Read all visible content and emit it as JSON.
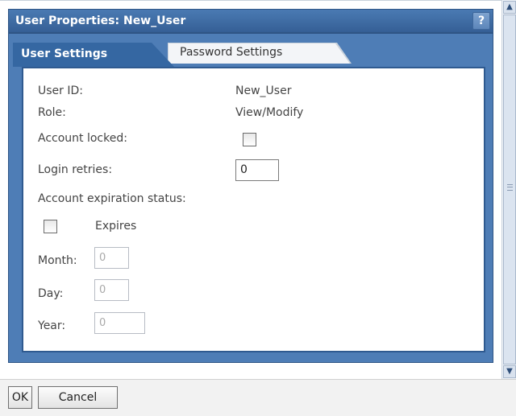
{
  "dialog": {
    "title": "User Properties: New_User",
    "help_label": "?"
  },
  "tabs": [
    {
      "label": "User Settings",
      "active": true
    },
    {
      "label": "Password Settings",
      "active": false
    }
  ],
  "form": {
    "user_id_label": "User ID:",
    "user_id_value": "New_User",
    "role_label": "Role:",
    "role_value": "View/Modify",
    "account_locked_label": "Account locked:",
    "account_locked_checked": false,
    "login_retries_label": "Login retries:",
    "login_retries_value": "0",
    "expiration_status_label": "Account expiration status:",
    "expires_label": "Expires",
    "expires_checked": false,
    "month_label": "Month:",
    "month_value": "0",
    "day_label": "Day:",
    "day_value": "0",
    "year_label": "Year:",
    "year_value": "0"
  },
  "scrollbar": {
    "up_icon": "chevron-up-icon",
    "down_icon": "chevron-down-icon"
  },
  "footer": {
    "ok_label": "OK",
    "cancel_label": "Cancel"
  },
  "colors": {
    "titlebar": "#3f6da6",
    "active_tab": "#3567a2",
    "panel_border": "#2f5a90",
    "inactive_tab": "#f3f5f8"
  }
}
